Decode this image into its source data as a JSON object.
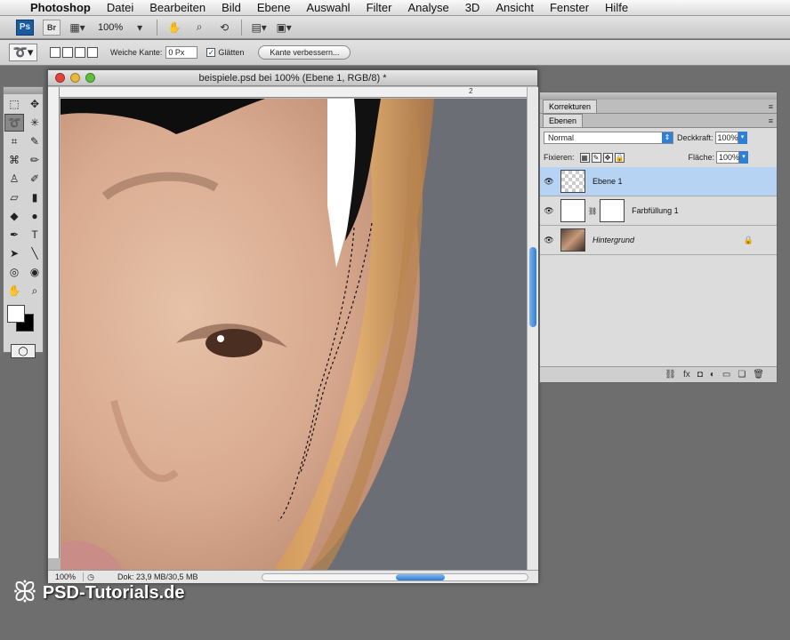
{
  "menubar": {
    "app": "Photoshop",
    "items": [
      "Datei",
      "Bearbeiten",
      "Bild",
      "Ebene",
      "Auswahl",
      "Filter",
      "Analyse",
      "3D",
      "Ansicht",
      "Fenster",
      "Hilfe"
    ]
  },
  "appbar": {
    "ps": "Ps",
    "br": "Br",
    "zoom": "100%"
  },
  "options": {
    "feather_label": "Weiche Kante:",
    "feather_value": "0 Px",
    "antialias_label": "Glätten",
    "refine_button": "Kante verbessern..."
  },
  "document": {
    "title": "beispiele.psd bei 100% (Ebene 1, RGB/8) *",
    "ruler_mark": "2",
    "zoom": "100%",
    "doc_info": "Dok: 23,9 MB/30,5 MB"
  },
  "panels": {
    "tab_corrections": "Korrekturen",
    "tab_layers": "Ebenen",
    "blend_mode": "Normal",
    "opacity_label": "Deckkraft:",
    "opacity_value": "100%",
    "lock_label": "Fixieren:",
    "fill_label": "Fläche:",
    "fill_value": "100%",
    "layers": [
      {
        "name": "Ebene 1",
        "active": true
      },
      {
        "name": "Farbfüllung 1",
        "active": false
      },
      {
        "name": "Hintergrund",
        "active": false
      }
    ]
  },
  "watermark": {
    "text": "PSD-Tutorials.de"
  },
  "colors": {
    "accent": "#2f7fd6",
    "active_layer": "#b6d3f4"
  }
}
